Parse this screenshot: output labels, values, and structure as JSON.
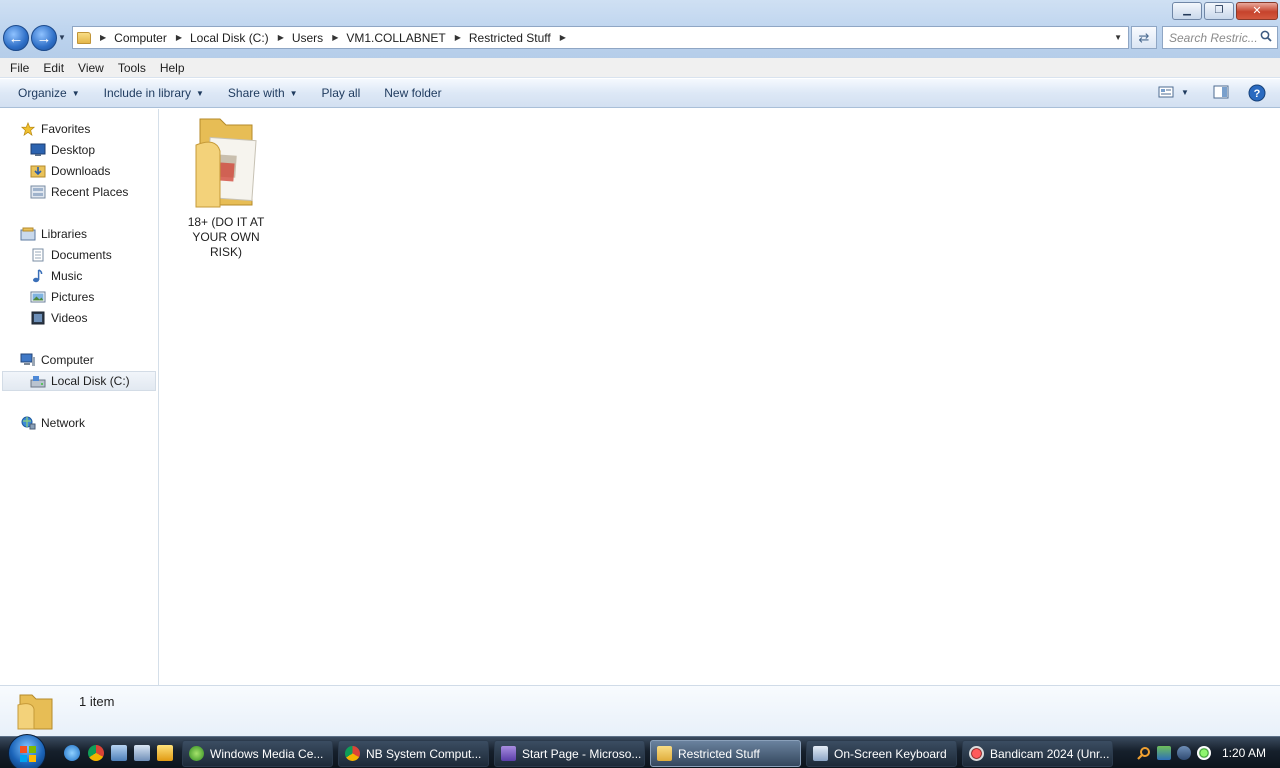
{
  "window": {
    "minimize_glyph": "▁",
    "maximize_glyph": "❐",
    "close_glyph": "✕"
  },
  "address": {
    "crumbs": [
      "Computer",
      "Local Disk (C:)",
      "Users",
      "VM1.COLLABNET",
      "Restricted Stuff"
    ],
    "search_placeholder": "Search Restric..."
  },
  "menu": [
    "File",
    "Edit",
    "View",
    "Tools",
    "Help"
  ],
  "commands": {
    "organize": "Organize",
    "include_in_library": "Include in library",
    "share_with": "Share with",
    "play_all": "Play all",
    "new_folder": "New folder"
  },
  "nav": {
    "favorites": "Favorites",
    "desktop": "Desktop",
    "downloads": "Downloads",
    "recent_places": "Recent Places",
    "libraries": "Libraries",
    "documents": "Documents",
    "music": "Music",
    "pictures": "Pictures",
    "videos": "Videos",
    "computer": "Computer",
    "local_disk": "Local Disk (C:)",
    "network": "Network"
  },
  "content": {
    "folder_name_line1": "18+ (DO IT AT",
    "folder_name_line2": "YOUR OWN RISK)"
  },
  "details": {
    "item_count": "1 item"
  },
  "taskbar": {
    "tasks": [
      "Windows Media Ce...",
      "NB System Comput...",
      "Start Page - Microso...",
      "Restricted Stuff",
      "On-Screen Keyboard",
      "Bandicam 2024 (Unr..."
    ],
    "clock": "1:20 AM"
  },
  "colors": {
    "accent": "#1e3a5e",
    "selection": "#e2e9f1"
  }
}
